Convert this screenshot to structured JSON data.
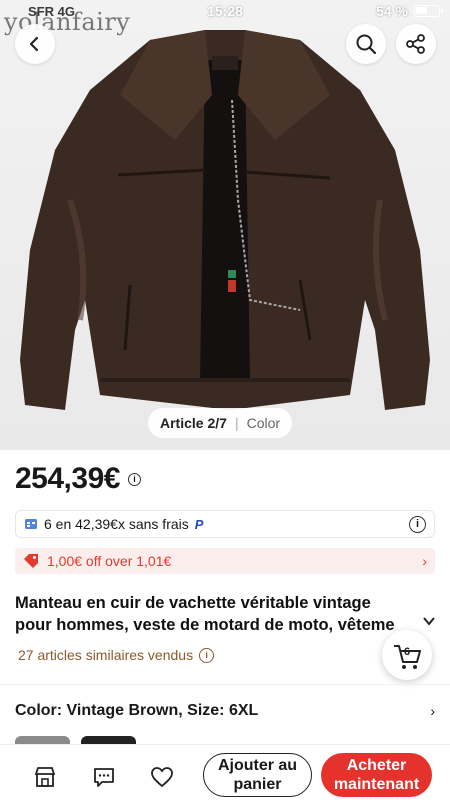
{
  "status_bar": {
    "carrier": "SFR 4G",
    "time": "15:28",
    "battery": "54 %",
    "battery_level": 0.54
  },
  "hero": {
    "watermark": "yolanfairy",
    "pager_main": "Article 2/7",
    "pager_sub": "Color"
  },
  "product": {
    "price": "254,39€",
    "installment_text": "6 en 42,39€x sans frais",
    "installment_brand": "P",
    "promo_text": "1,00€ off over 1,01€",
    "title_line1": "Manteau en cuir de vachette véritable vintage",
    "title_line2": "pour hommes, veste de motard de moto, vêteme",
    "sold_text": "27 articles similaires vendus",
    "variant_text": "Color: Vintage Brown, Size: 6XL"
  },
  "cart_badge": "6",
  "actions": {
    "add_to_cart": "Ajouter au panier",
    "buy_now": "Acheter maintenant"
  },
  "colors": {
    "accent_red": "#e5322c",
    "promo_bg": "#fdeeee",
    "sold_brown": "#8a5a2b",
    "jacket_brown": "#3b2a22"
  },
  "icons": {
    "back": "chevron-left-icon",
    "search": "search-icon",
    "share": "share-icon",
    "store": "store-icon",
    "chat": "chat-icon",
    "wishlist": "heart-icon",
    "cart": "cart-icon"
  }
}
